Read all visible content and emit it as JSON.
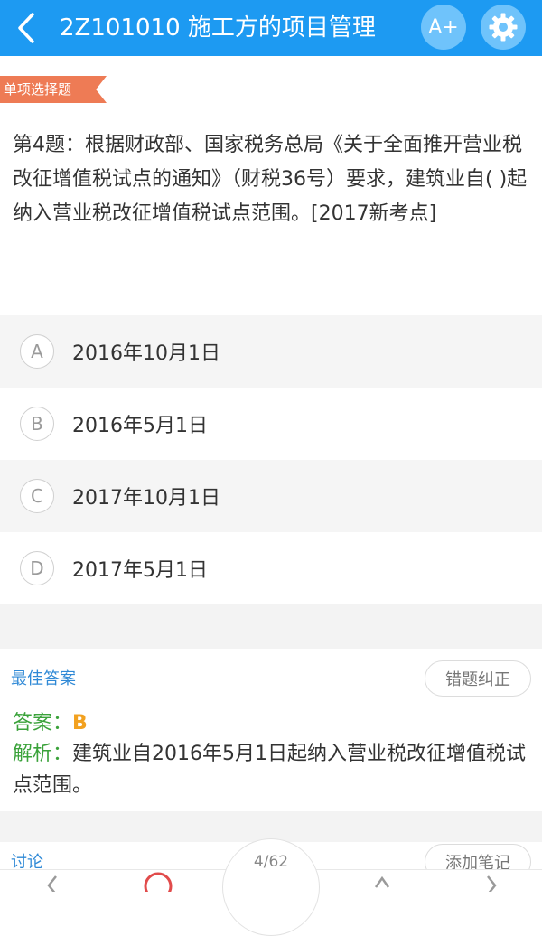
{
  "header": {
    "title": "2Z101010 施工方的项目管理",
    "font_button_label": "A+",
    "icons": [
      "back-icon",
      "font-size-icon",
      "settings-icon"
    ]
  },
  "question": {
    "type_badge": "单项选择题",
    "text": "第4题：根据财政部、国家税务总局《关于全面推开营业税改征增值税试点的通知》（财税36号）要求，建筑业自(    )起纳入营业税改征增值税试点范围。[2017新考点]",
    "options": [
      {
        "letter": "A",
        "text": "2016年10月1日"
      },
      {
        "letter": "B",
        "text": "2016年5月1日"
      },
      {
        "letter": "C",
        "text": "2017年10月1日"
      },
      {
        "letter": "D",
        "text": "2017年5月1日"
      }
    ]
  },
  "answer_section": {
    "heading": "最佳答案",
    "report_button": "错题纠正",
    "answer_label": "答案：",
    "answer_value": "B",
    "analysis_label": "解析：",
    "analysis_text": "建筑业自2016年5月1日起纳入营业税改征增值税试点范围。"
  },
  "bottom": {
    "comment_label": "讨论",
    "comment_button": "添加笔记",
    "page_indicator": "4/62"
  },
  "colors": {
    "header_bg": "#1d9af2",
    "badge_bg": "#ee7b55",
    "link_blue": "#2f89d6",
    "label_green": "#3aa23a",
    "answer_orange": "#f2a11f"
  }
}
